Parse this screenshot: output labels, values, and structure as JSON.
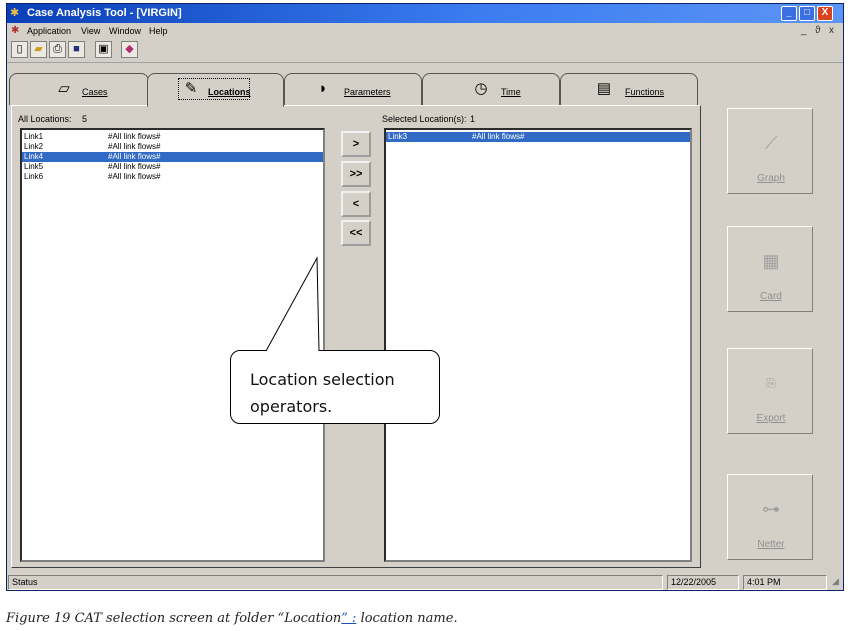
{
  "window": {
    "title": "Case Analysis Tool - [VIRGIN]",
    "controls": {
      "minimize": "_",
      "maximize": "□",
      "close": "X"
    }
  },
  "menubar": {
    "items": [
      "Application",
      "View",
      "Window",
      "Help"
    ],
    "mdi_controls": [
      "_",
      "ϑ",
      "x"
    ]
  },
  "toolbar": {
    "icons": [
      "new-document-icon",
      "open-folder-icon",
      "print-icon",
      "save-icon",
      "properties-icon",
      "eraser-icon"
    ]
  },
  "tabs": [
    {
      "label": "Cases",
      "icon": "folder-icon",
      "active": false
    },
    {
      "label": "Locations",
      "icon": "map-icon",
      "active": true
    },
    {
      "label": "Parameters",
      "icon": "sound-icon",
      "active": false
    },
    {
      "label": "Time",
      "icon": "clock-icon",
      "active": false
    },
    {
      "label": "Functions",
      "icon": "function-sheet-icon",
      "active": false
    }
  ],
  "locations": {
    "all_label": "All Locations:",
    "all_count": "5",
    "selected_label": "Selected Location(s):",
    "selected_count": "1",
    "all_items": [
      {
        "name": "Link1",
        "flow": "#All link flows#",
        "selected": false
      },
      {
        "name": "Link2",
        "flow": "#All link flows#",
        "selected": false
      },
      {
        "name": "Link4",
        "flow": "#All link flows#",
        "selected": true
      },
      {
        "name": "Link5",
        "flow": "#All link flows#",
        "selected": false
      },
      {
        "name": "Link6",
        "flow": "#All link flows#",
        "selected": false
      }
    ],
    "selected_items": [
      {
        "name": "Link3",
        "flow": "#All link flows#",
        "selected": true
      }
    ]
  },
  "move_buttons": [
    ">",
    ">>",
    "<",
    "<<"
  ],
  "side_buttons": [
    {
      "label": "Graph",
      "icon": "graph-icon"
    },
    {
      "label": "Card",
      "icon": "card-icon"
    },
    {
      "label": "Export",
      "icon": "export-icon"
    },
    {
      "label": "Netter",
      "icon": "network-icon"
    }
  ],
  "statusbar": {
    "status": "Status",
    "date": "12/22/2005",
    "time": "4:01 PM"
  },
  "callout": {
    "text": "Location selection operators."
  },
  "caption": {
    "prefix": "Figure 19 CAT selection screen at folder “Location",
    "link": "” :",
    "suffix": " location name."
  },
  "colors": {
    "titlebar": "#0a3fb8",
    "selection": "#316ac5",
    "face": "#d4d0c8"
  }
}
